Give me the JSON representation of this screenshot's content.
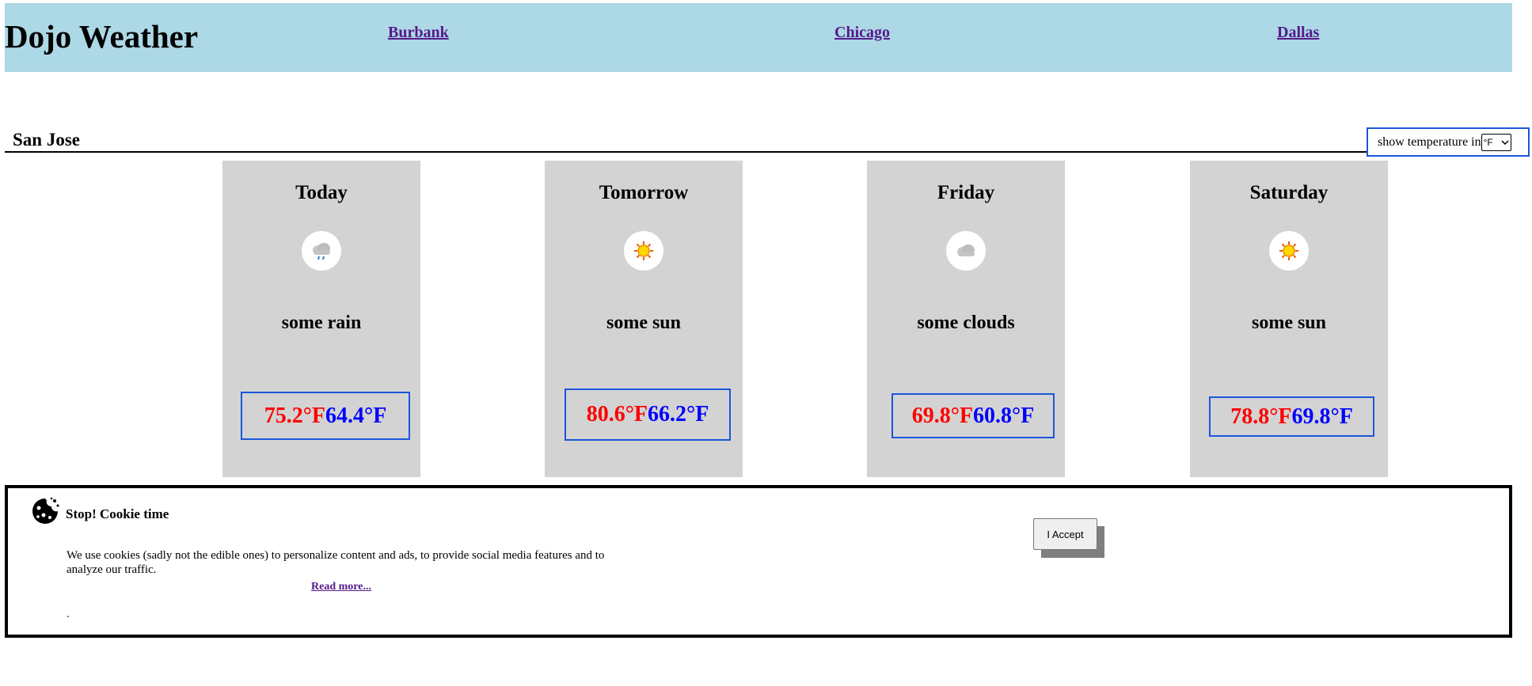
{
  "header": {
    "title": "Dojo Weather",
    "nav": [
      "Burbank",
      "Chicago",
      "Dallas"
    ]
  },
  "location": {
    "city": "San Jose",
    "unit_label": "show temperature in",
    "unit_selected": "°F"
  },
  "forecast": [
    {
      "day": "Today",
      "condition": "some rain",
      "high": "75.2°F",
      "low": "64.4°F",
      "icon": "rain-cloud-icon"
    },
    {
      "day": "Tomorrow",
      "condition": "some sun",
      "high": "80.6°F",
      "low": "66.2°F",
      "icon": "sun-icon"
    },
    {
      "day": "Friday",
      "condition": "some clouds",
      "high": "69.8°F",
      "low": "60.8°F",
      "icon": "cloud-icon"
    },
    {
      "day": "Saturday",
      "condition": "some sun",
      "high": "78.8°F",
      "low": "69.8°F",
      "icon": "sun-icon"
    }
  ],
  "cookie": {
    "title": "Stop! Cookie time",
    "text": "We use cookies (sadly not the edible ones) to personalize content and ads, to provide social media features and to analyze our traffic.",
    "read_more": "Read more...",
    "dot": ".",
    "accept": "I Accept"
  },
  "colors": {
    "header_bg": "#add8e6",
    "card_bg": "#d3d3d3",
    "high_temp": "#ff0000",
    "low_temp": "#0000ff",
    "box_border": "#1a56db"
  }
}
